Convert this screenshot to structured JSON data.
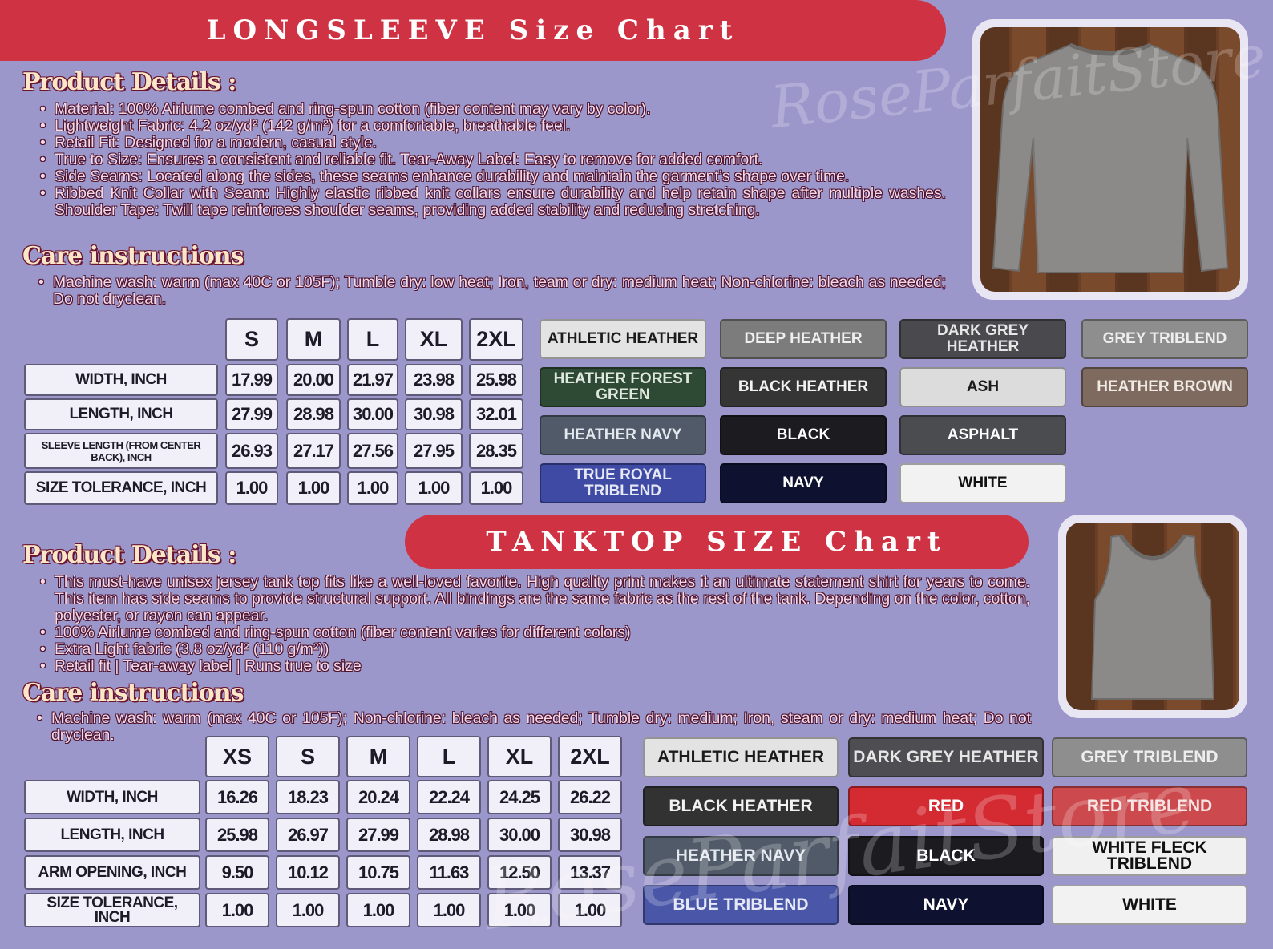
{
  "longsleeve": {
    "title": "LONGSLEEVE Size Chart",
    "product_heading": "Product Details :",
    "product_bullets": [
      "Material: 100% Airlume combed and ring-spun cotton (fiber content may vary by color).",
      "Lightweight Fabric: 4.2 oz/yd² (142 g/m²) for a comfortable, breathable feel.",
      "Retail Fit: Designed for a modern, casual style.",
      "True to Size: Ensures a consistent and reliable fit. Tear-Away Label: Easy to remove for added comfort.",
      "Side Seams: Located along the sides, these seams enhance durability and maintain the garment’s shape over time.",
      "Ribbed Knit Collar with Seam: Highly elastic ribbed knit collars ensure durability and help retain shape after multiple washes. Shoulder Tape: Twill tape reinforces shoulder seams, providing added stability and reducing stretching."
    ],
    "care_heading": "Care instructions",
    "care_bullets": [
      "Machine wash: warm (max 40C or 105F); Tumble dry: low heat; Iron, team or dry: medium heat; Non-chlorine: bleach as needed; Do not dryclean."
    ],
    "table": {
      "sizes": [
        "S",
        "M",
        "L",
        "XL",
        "2XL"
      ],
      "rows": [
        {
          "label": "WIDTH, INCH",
          "values": [
            "17.99",
            "20.00",
            "21.97",
            "23.98",
            "25.98"
          ]
        },
        {
          "label": "LENGTH, INCH",
          "values": [
            "27.99",
            "28.98",
            "30.00",
            "30.98",
            "32.01"
          ]
        },
        {
          "label": "SLEEVE LENGTH (FROM CENTER BACK), INCH",
          "values": [
            "26.93",
            "27.17",
            "27.56",
            "27.95",
            "28.35"
          ]
        },
        {
          "label": "SIZE TOLERANCE, INCH",
          "values": [
            "1.00",
            "1.00",
            "1.00",
            "1.00",
            "1.00"
          ]
        }
      ]
    },
    "colors": [
      {
        "name": "ATHLETIC HEATHER",
        "bg": "#e3e3e3",
        "fg": "#1b1b1b"
      },
      {
        "name": "DEEP HEATHER",
        "bg": "#7c7c7c",
        "fg": "#f0f0f0"
      },
      {
        "name": "DARK GREY HEATHER",
        "bg": "#4a4a4e",
        "fg": "#e6e6e6"
      },
      {
        "name": "GREY TRIBLEND",
        "bg": "#8e8e8e",
        "fg": "#eeeeee"
      },
      {
        "name": "HEATHER FOREST GREEN",
        "bg": "#2e4a34",
        "fg": "#dfe8df"
      },
      {
        "name": "BLACK HEATHER",
        "bg": "#353535",
        "fg": "#f2f2f2"
      },
      {
        "name": "ASH",
        "bg": "#dcdcdc",
        "fg": "#1b1b1b"
      },
      {
        "name": "HEATHER BROWN",
        "bg": "#7e6a5e",
        "fg": "#f0eae4"
      },
      {
        "name": "HEATHER NAVY",
        "bg": "#505a68",
        "fg": "#e3e7ee"
      },
      {
        "name": "BLACK",
        "bg": "#1b1b20",
        "fg": "#ffffff"
      },
      {
        "name": "ASPHALT",
        "bg": "#4a4c50",
        "fg": "#ffffff"
      },
      {
        "name": "TRUE ROYAL TRIBLEND",
        "bg": "#3e4aa4",
        "fg": "#e6e8f6"
      },
      {
        "name": "NAVY",
        "bg": "#0e1230",
        "fg": "#ffffff"
      },
      {
        "name": "WHITE",
        "bg": "#f2f2f2",
        "fg": "#111111"
      }
    ]
  },
  "tanktop": {
    "title": "TANKTOP SIZE Chart",
    "product_heading": "Product Details :",
    "product_bullets": [
      "This must-have unisex jersey tank top fits like a well-loved favorite. High quality print makes it an ultimate statement shirt for years to come. This item has side seams to provide structural support. All bindings are the same fabric as the rest of the tank. Depending on the color, cotton, polyester, or rayon can appear.",
      "100% Airlume combed and ring-spun cotton (fiber content varies for different colors)",
      "Extra Light fabric (3.8 oz/yd² (110 g/m²))",
      "Retail fit |  Tear-away label  |  Runs true to size"
    ],
    "care_heading": "Care instructions",
    "care_bullets": [
      "Machine wash: warm (max 40C or 105F); Non-chlorine: bleach as needed; Tumble dry: medium; Iron, steam or dry: medium heat; Do not dryclean."
    ],
    "table": {
      "sizes": [
        "XS",
        "S",
        "M",
        "L",
        "XL",
        "2XL"
      ],
      "rows": [
        {
          "label": "WIDTH, INCH",
          "values": [
            "16.26",
            "18.23",
            "20.24",
            "22.24",
            "24.25",
            "26.22"
          ]
        },
        {
          "label": "LENGTH, INCH",
          "values": [
            "25.98",
            "26.97",
            "27.99",
            "28.98",
            "30.00",
            "30.98"
          ]
        },
        {
          "label": "ARM OPENING, INCH",
          "values": [
            "9.50",
            "10.12",
            "10.75",
            "11.63",
            "12.50",
            "13.37"
          ]
        },
        {
          "label": "SIZE TOLERANCE, INCH",
          "values": [
            "1.00",
            "1.00",
            "1.00",
            "1.00",
            "1.00",
            "1.00"
          ]
        }
      ]
    },
    "colors": [
      {
        "name": "ATHLETIC HEATHER",
        "bg": "#e3e3e3",
        "fg": "#1b1b1b"
      },
      {
        "name": "DARK GREY HEATHER",
        "bg": "#4e4e52",
        "fg": "#e6e6e6"
      },
      {
        "name": "GREY TRIBLEND",
        "bg": "#8e8e8e",
        "fg": "#eeeeee"
      },
      {
        "name": "BLACK HEATHER",
        "bg": "#323232",
        "fg": "#f2f2f2"
      },
      {
        "name": "RED",
        "bg": "#d42a32",
        "fg": "#ffffff"
      },
      {
        "name": "RED TRIBLEND",
        "bg": "#cc4a4e",
        "fg": "#f6e2e2"
      },
      {
        "name": "HEATHER NAVY",
        "bg": "#505a68",
        "fg": "#e3e7ee"
      },
      {
        "name": "BLACK",
        "bg": "#1b1b20",
        "fg": "#ffffff"
      },
      {
        "name": "WHITE FLECK TRIBLEND",
        "bg": "#f0f0f0",
        "fg": "#111111"
      },
      {
        "name": "BLUE TRIBLEND",
        "bg": "#4a56a8",
        "fg": "#e6e8f6"
      },
      {
        "name": "NAVY",
        "bg": "#0e1230",
        "fg": "#ffffff"
      },
      {
        "name": "WHITE",
        "bg": "#f2f2f2",
        "fg": "#111111"
      }
    ]
  },
  "watermark": "RoseParfaitStore"
}
